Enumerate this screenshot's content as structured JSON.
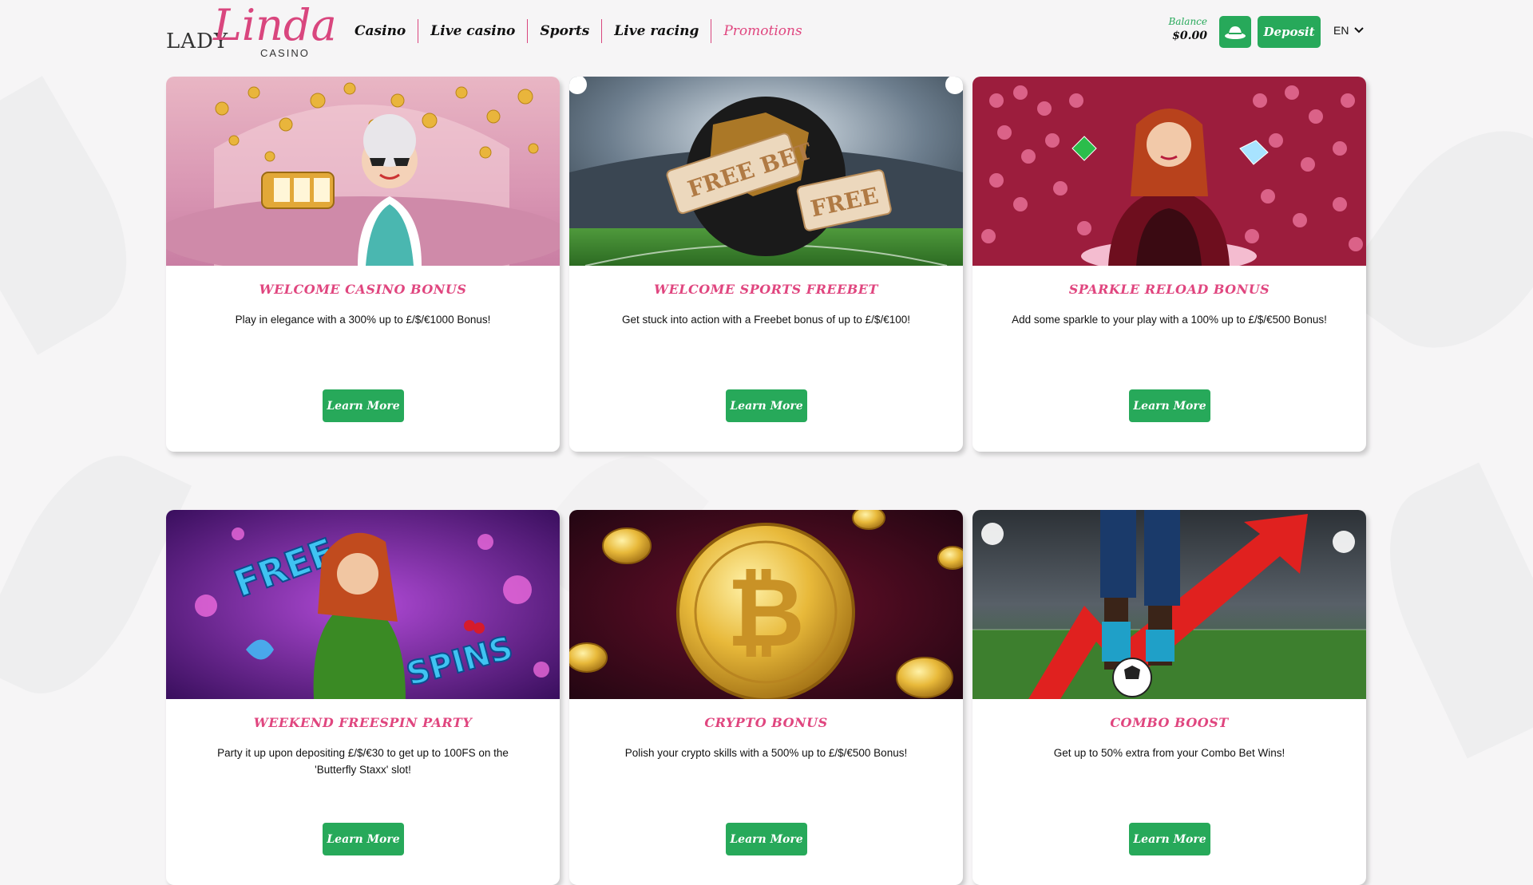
{
  "logo": {
    "lady": "LADY",
    "linda": "Linda",
    "casino": "CASINO"
  },
  "nav": {
    "items": [
      {
        "label": "Casino",
        "active": false
      },
      {
        "label": "Live casino",
        "active": false
      },
      {
        "label": "Sports",
        "active": false
      },
      {
        "label": "Live racing",
        "active": false
      },
      {
        "label": "Promotions",
        "active": true
      }
    ]
  },
  "account": {
    "balance_label": "Balance",
    "balance_amount": "$0.00",
    "hat_icon": "hat-icon",
    "deposit_label": "Deposit",
    "language": "EN"
  },
  "colors": {
    "accent_pink": "#e0467f",
    "button_green": "#27a95a",
    "background": "#f6f5f6"
  },
  "promotions": [
    {
      "title": "WELCOME CASINO BONUS",
      "description": "Play in elegance with a 300% up to £/$/€1000 Bonus!",
      "button": "Learn More"
    },
    {
      "title": "WELCOME SPORTS FREEBET",
      "description": "Get stuck into action with a Freebet bonus of up to £/$/€100!",
      "button": "Learn More",
      "image_text": [
        "FREE BET",
        "FREE"
      ]
    },
    {
      "title": "SPARKLE RELOAD BONUS",
      "description": "Add some sparkle to your play with a 100% up to £/$/€500 Bonus!",
      "button": "Learn More"
    },
    {
      "title": "WEEKEND FREESPIN PARTY",
      "description": "Party it up upon depositing £/$/€30 to get up to 100FS on the 'Butterfly Staxx' slot!",
      "button": "Learn More",
      "image_text": [
        "FREE",
        "SPINS"
      ]
    },
    {
      "title": "CRYPTO BONUS",
      "description": "Polish your crypto skills with a 500% up to £/$/€500 Bonus!",
      "button": "Learn More"
    },
    {
      "title": "COMBO BOOST",
      "description": "Get up to 50% extra from your Combo Bet Wins!",
      "button": "Learn More"
    }
  ]
}
